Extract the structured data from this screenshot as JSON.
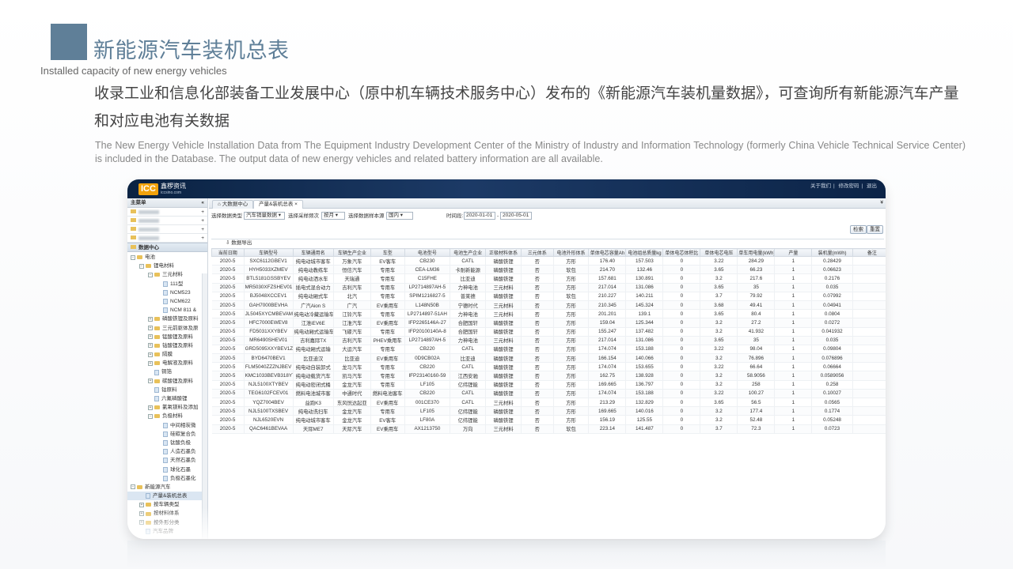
{
  "title": {
    "cn": "新能源汽车装机总表",
    "en": "Installed capacity of new energy vehicles"
  },
  "description": {
    "cn": "收录工业和信息化部装备工业发展中心（原中机车辆技术服务中心）发布的《新能源汽车装机量数据》，可查询所有新能源汽车产量和对应电池有关数据",
    "en": "The New Energy Vehicle Installation Data from The Equipment Industry Development Center of the Ministry of Industry and Information Technology (formerly China Vehicle Technical Service Center) is included in the Database. The output data of new energy vehicles and related battery information are all available."
  },
  "app": {
    "logo_mark": "ICC",
    "logo_text": "鑫椤资讯",
    "logo_sub": "iccsino.com",
    "top_links": [
      "关于我们",
      "修改密码",
      "退出"
    ]
  },
  "sidebar": {
    "header": "主菜单",
    "collapse": "«",
    "groups": [
      "",
      "",
      "",
      ""
    ],
    "active": "数据中心",
    "tree": [
      {
        "label": "电池",
        "level": 0,
        "type": "folder",
        "pm": "−"
      },
      {
        "label": "锂电材料",
        "level": 1,
        "type": "folder",
        "pm": "−"
      },
      {
        "label": "三元材料",
        "level": 2,
        "type": "folder",
        "pm": "−"
      },
      {
        "label": "111型",
        "level": 3,
        "type": "leaf"
      },
      {
        "label": "NCM523",
        "level": 3,
        "type": "leaf"
      },
      {
        "label": "NCM622",
        "level": 3,
        "type": "leaf"
      },
      {
        "label": "NCM 811 &",
        "level": 3,
        "type": "leaf"
      },
      {
        "label": "磷酸铁锂及原料",
        "level": 2,
        "type": "folder",
        "pm": "+"
      },
      {
        "label": "三元前驱体及原",
        "level": 2,
        "type": "folder",
        "pm": "+"
      },
      {
        "label": "锰酸锂及原料",
        "level": 2,
        "type": "folder",
        "pm": "+"
      },
      {
        "label": "钴酸锂及原料",
        "level": 2,
        "type": "folder",
        "pm": "+"
      },
      {
        "label": "隔膜",
        "level": 2,
        "type": "folder",
        "pm": "+"
      },
      {
        "label": "电解液及原料",
        "level": 2,
        "type": "folder",
        "pm": "+"
      },
      {
        "label": "铜箔",
        "level": 2,
        "type": "leaf"
      },
      {
        "label": "碳酸锂及原料",
        "level": 2,
        "type": "folder",
        "pm": "+"
      },
      {
        "label": "钴原料",
        "level": 2,
        "type": "leaf"
      },
      {
        "label": "六氟磷酸锂",
        "level": 2,
        "type": "leaf"
      },
      {
        "label": "氯氧镁料及添加",
        "level": 2,
        "type": "folder",
        "pm": "+"
      },
      {
        "label": "负极材料",
        "level": 2,
        "type": "folder",
        "pm": "−"
      },
      {
        "label": "中间相炭微",
        "level": 3,
        "type": "leaf"
      },
      {
        "label": "硅碳复合负",
        "level": 3,
        "type": "leaf"
      },
      {
        "label": "钛酸负极",
        "level": 3,
        "type": "leaf"
      },
      {
        "label": "人造石墨负",
        "level": 3,
        "type": "leaf"
      },
      {
        "label": "天然石墨负",
        "level": 3,
        "type": "leaf"
      },
      {
        "label": "球化石墨",
        "level": 3,
        "type": "leaf"
      },
      {
        "label": "负极石墨化",
        "level": 3,
        "type": "leaf"
      },
      {
        "label": "新能源汽车",
        "level": 0,
        "type": "folder",
        "pm": "−"
      },
      {
        "label": "产量&装机总表",
        "level": 1,
        "type": "leaf",
        "selected": true
      },
      {
        "label": "按车辆类型",
        "level": 1,
        "type": "folder",
        "pm": "+"
      },
      {
        "label": "按材料体系",
        "level": 1,
        "type": "folder",
        "pm": "+"
      },
      {
        "label": "按外形分类",
        "level": 1,
        "type": "folder",
        "pm": "+"
      },
      {
        "label": "汽车品牌",
        "level": 1,
        "type": "leaf"
      }
    ]
  },
  "tabs": [
    {
      "label": "⌂ 大数据中心"
    },
    {
      "label": "产量&装机总表",
      "close": "×"
    }
  ],
  "filters": {
    "type_label": "选择数据类型",
    "type_value": "汽车销量数据 ▾",
    "freq_label": "选择采样频次",
    "freq_value": "按月 ▾",
    "version_label": "选择数据样本源",
    "version_value": "国内 ▾",
    "date_label": "时间段:",
    "date_from": "2020-01-01",
    "date_sep": "-",
    "date_to": "2020-05-01",
    "search": "检索",
    "reset": "重置"
  },
  "export_label": "⇩ 数据导出",
  "table": {
    "columns": [
      "当前日期",
      "车辆型号",
      "车辆通用名",
      "车辆生产企业",
      "车型",
      "电池型号",
      "电池生产企业",
      "正极材料体系",
      "三元体系",
      "电池外形体系",
      "单体电芯容量Ah",
      "电池组总质量kg",
      "单体电芯体积比",
      "单体电芯电压",
      "单车用电量(kWh)",
      "产量",
      "装机量(mWh)",
      "备注"
    ],
    "rows": [
      [
        "2020-5",
        "SXC6112GBEV1",
        "纯电动城市客车",
        "万象汽车",
        "EV客车",
        "CB230",
        "CATL",
        "磷酸铁锂",
        "否",
        "方形",
        "176.40",
        "157.503",
        "0",
        "3.22",
        "284.29",
        "1",
        "0.28429",
        ""
      ],
      [
        "2020-5",
        "HYH5033XZMEV",
        "纯电动教练车",
        "恒信汽车",
        "专用车",
        "CEA-LM36",
        "卡耐新能源",
        "磷酸铁锂",
        "否",
        "软包",
        "214.70",
        "132.46",
        "0",
        "3.65",
        "66.23",
        "1",
        "0.06623",
        ""
      ],
      [
        "2020-5",
        "BTL5181GSSBYEV",
        "纯电动洒水车",
        "天瑞通",
        "专用车",
        "C15FHE",
        "比亚迪",
        "磷酸铁锂",
        "否",
        "方形",
        "157.681",
        "130.891",
        "0",
        "3.2",
        "217.6",
        "1",
        "0.2176",
        ""
      ],
      [
        "2020-5",
        "MR5030XFZSHEV01",
        "插电式混合动力",
        "吉利汽车",
        "专用车",
        "LP2714897AH-5",
        "力神电池",
        "三元材料",
        "否",
        "方形",
        "217.014",
        "131.086",
        "0",
        "3.65",
        "35",
        "1",
        "0.035",
        ""
      ],
      [
        "2020-5",
        "BJ5048XCCEV1",
        "纯电动厢式车",
        "北汽",
        "专用车",
        "SPIM1216827-5",
        "普莱德",
        "磷酸铁锂",
        "否",
        "软包",
        "210.227",
        "140.211",
        "0",
        "3.7",
        "79.92",
        "1",
        "0.07992",
        ""
      ],
      [
        "2020-5",
        "GAH7000BEVHA",
        "广汽Aion S",
        "广汽",
        "EV乘用车",
        "L148N50B",
        "宁德时代",
        "三元材料",
        "否",
        "方形",
        "210.345",
        "145.324",
        "0",
        "3.68",
        "49.41",
        "1",
        "0.04941",
        ""
      ],
      [
        "2020-5",
        "JL5045XYCMBEVAM",
        "纯电动冷藏运输车",
        "江铃汽车",
        "专用车",
        "LP2714897-51AH",
        "力神电池",
        "三元材料",
        "否",
        "方形",
        "201.201",
        "139.1",
        "0",
        "3.65",
        "80.4",
        "1",
        "0.0804",
        ""
      ],
      [
        "2020-5",
        "HFC7000EWEV8",
        "江淮iEV6E",
        "江淮汽车",
        "EV乘用车",
        "IFP2265146A-27",
        "合肥国轩",
        "磷酸铁锂",
        "否",
        "方形",
        "159.04",
        "125.344",
        "0",
        "3.2",
        "27.2",
        "1",
        "0.0272",
        ""
      ],
      [
        "2020-5",
        "FD5031XXYBEV",
        "纯电动厢式运输车",
        "飞碟汽车",
        "专用车",
        "IFP20100140A-8",
        "合肥国轩",
        "磷酸铁锂",
        "否",
        "方形",
        "155.247",
        "137.482",
        "0",
        "3.2",
        "41.932",
        "1",
        "0.041932",
        ""
      ],
      [
        "2020-5",
        "MR6490SHEV01",
        "吉利嘉际TX",
        "吉利汽车",
        "PHEV乘用车",
        "LP2714897AH-5",
        "力神电池",
        "三元材料",
        "否",
        "方形",
        "217.014",
        "131.086",
        "0",
        "3.65",
        "35",
        "1",
        "0.035",
        ""
      ],
      [
        "2020-5",
        "GRD5095XXYBEV1Z1",
        "纯电动厢式运输",
        "大运汽车",
        "专用车",
        "CB220",
        "CATL",
        "磷酸铁锂",
        "否",
        "方形",
        "174.074",
        "153.188",
        "0",
        "3.22",
        "98.04",
        "1",
        "0.09804",
        ""
      ],
      [
        "2020-5",
        "BYD6470BEV1",
        "比亚迪汉",
        "比亚迪",
        "EV乘用车",
        "0D9CB02A",
        "比亚迪",
        "磷酸铁锂",
        "否",
        "方形",
        "166.154",
        "140.066",
        "0",
        "3.2",
        "76.896",
        "1",
        "0.076896",
        ""
      ],
      [
        "2020-5",
        "FLM5040ZZZNJBEV",
        "纯电动自装卸式",
        "龙马汽车",
        "专用车",
        "CB220",
        "CATL",
        "磷酸铁锂",
        "否",
        "方形",
        "174.074",
        "153.655",
        "0",
        "3.22",
        "66.64",
        "1",
        "0.06664",
        ""
      ],
      [
        "2020-5",
        "KMC1033BEVB318YT",
        "纯电动载货汽车",
        "凯马汽车",
        "专用车",
        "IFP23140160-59",
        "江西安驰",
        "磷酸铁锂",
        "否",
        "方形",
        "162.75",
        "138.928",
        "0",
        "3.2",
        "58.9056",
        "1",
        "0.0589056",
        ""
      ],
      [
        "2020-5",
        "NJL5100XTYBEV",
        "纯电动密闭式桶",
        "金龙汽车",
        "专用车",
        "LF105",
        "亿纬锂能",
        "磷酸铁锂",
        "否",
        "方形",
        "169.665",
        "136.797",
        "0",
        "3.2",
        "258",
        "1",
        "0.258",
        ""
      ],
      [
        "2020-5",
        "TEG6102FCEV01",
        "燃料电池城市客",
        "中通时代",
        "燃料电池客车",
        "CB220",
        "CATL",
        "磷酸铁锂",
        "否",
        "方形",
        "174.074",
        "153.188",
        "0",
        "3.22",
        "100.27",
        "1",
        "0.10027",
        ""
      ],
      [
        "2020-5",
        "YQZ7004BEV",
        "益跑K3",
        "东风悦达起亚",
        "EV乘用车",
        "001CE370",
        "CATL",
        "三元材料",
        "否",
        "方形",
        "213.29",
        "132.829",
        "0",
        "3.65",
        "56.5",
        "1",
        "0.0565",
        ""
      ],
      [
        "2020-5",
        "NJL5100TXSBEV",
        "纯电动洗扫车",
        "金龙汽车",
        "专用车",
        "LF105",
        "亿纬锂能",
        "磷酸铁锂",
        "否",
        "方形",
        "169.665",
        "140.016",
        "0",
        "3.2",
        "177.4",
        "1",
        "0.1774",
        ""
      ],
      [
        "2020-5",
        "NJL6520EVN",
        "纯电动城市客车",
        "金龙汽车",
        "EV客车",
        "LF80A",
        "亿纬锂能",
        "磷酸铁锂",
        "否",
        "方形",
        "156.19",
        "125.55",
        "0",
        "3.2",
        "52.48",
        "1",
        "0.05248",
        ""
      ],
      [
        "2020-5",
        "QAC6461BEVAA",
        "天际ME7",
        "天际汽车",
        "EV乘用车",
        "AX1213750",
        "万向",
        "三元材料",
        "否",
        "软包",
        "223.14",
        "141.487",
        "0",
        "3.7",
        "72.3",
        "1",
        "0.0723",
        ""
      ]
    ]
  },
  "colors": {
    "accent": "#5f7f98",
    "topbar": "#0f2a4f",
    "logo": "#f2a20c"
  }
}
